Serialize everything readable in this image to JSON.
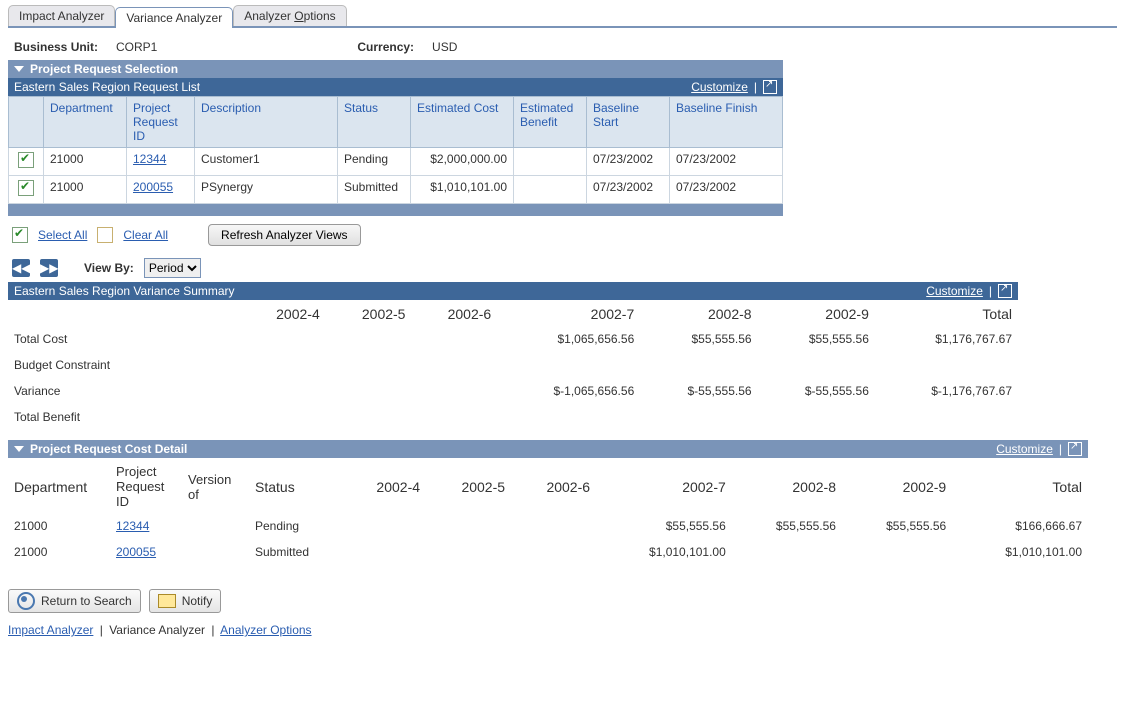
{
  "tabs": {
    "impact": "Impact Analyzer",
    "variance": "Variance Analyzer",
    "options": "Analyzer Options"
  },
  "header": {
    "bu_label": "Business Unit:",
    "bu": "CORP1",
    "curr_label": "Currency:",
    "curr": "USD"
  },
  "section1": {
    "title": "Project Request Selection"
  },
  "reqlist": {
    "title": "Eastern Sales Region Request List",
    "customize": "Customize",
    "cols": {
      "dept": "Department",
      "prid": "Project Request ID",
      "desc": "Description",
      "status": "Status",
      "ecost": "Estimated Cost",
      "ebenefit": "Estimated Benefit",
      "bstart": "Baseline Start",
      "bfinish": "Baseline Finish"
    },
    "rows": [
      {
        "dept": "21000",
        "prid": "12344",
        "desc": "Customer1",
        "status": "Pending",
        "ecost": "$2,000,000.00",
        "ebenefit": "",
        "bstart": "07/23/2002",
        "bfinish": "07/23/2002"
      },
      {
        "dept": "21000",
        "prid": "200055",
        "desc": "PSynergy",
        "status": "Submitted",
        "ecost": "$1,010,101.00",
        "ebenefit": "",
        "bstart": "07/23/2002",
        "bfinish": "07/23/2002"
      }
    ]
  },
  "controls": {
    "select_all": "Select All",
    "clear_all": "Clear All",
    "refresh": "Refresh Analyzer Views"
  },
  "viewby": {
    "label": "View By:",
    "value": "Period",
    "options": [
      "Period"
    ]
  },
  "summary": {
    "title": "Eastern Sales Region Variance Summary",
    "customize": "Customize",
    "cols": [
      "2002-4",
      "2002-5",
      "2002-6",
      "2002-7",
      "2002-8",
      "2002-9",
      "Total"
    ],
    "rows": [
      {
        "label": "Total Cost",
        "vals": [
          "",
          "",
          "",
          "$1,065,656.56",
          "$55,555.56",
          "$55,555.56",
          "$1,176,767.67"
        ]
      },
      {
        "label": "Budget Constraint",
        "vals": [
          "",
          "",
          "",
          "",
          "",
          "",
          ""
        ]
      },
      {
        "label": "Variance",
        "vals": [
          "",
          "",
          "",
          "$-1,065,656.56",
          "$-55,555.56",
          "$-55,555.56",
          "$-1,176,767.67"
        ]
      },
      {
        "label": "Total Benefit",
        "vals": [
          "",
          "",
          "",
          "",
          "",
          "",
          ""
        ]
      }
    ]
  },
  "detail": {
    "title": "Project Request Cost Detail",
    "customize": "Customize",
    "cols": {
      "dept": "Department",
      "prid": "Project Request ID",
      "ver": "Version of",
      "status": "Status"
    },
    "period_cols": [
      "2002-4",
      "2002-5",
      "2002-6",
      "2002-7",
      "2002-8",
      "2002-9",
      "Total"
    ],
    "rows": [
      {
        "dept": "21000",
        "prid": "12344",
        "ver": "",
        "status": "Pending",
        "vals": [
          "",
          "",
          "",
          "$55,555.56",
          "$55,555.56",
          "$55,555.56",
          "$166,666.67"
        ]
      },
      {
        "dept": "21000",
        "prid": "200055",
        "ver": "",
        "status": "Submitted",
        "vals": [
          "",
          "",
          "",
          "$1,010,101.00",
          "",
          "",
          "$1,010,101.00"
        ]
      }
    ]
  },
  "bottom": {
    "rts": "Return to Search",
    "notify": "Notify"
  },
  "footer_links": {
    "impact": "Impact Analyzer",
    "variance": "Variance Analyzer",
    "options": "Analyzer Options"
  },
  "chart_data": {
    "type": "table",
    "title": "Eastern Sales Region Variance Summary",
    "categories": [
      "2002-4",
      "2002-5",
      "2002-6",
      "2002-7",
      "2002-8",
      "2002-9",
      "Total"
    ],
    "series": [
      {
        "name": "Total Cost",
        "values": [
          null,
          null,
          null,
          1065656.56,
          55555.56,
          55555.56,
          1176767.67
        ]
      },
      {
        "name": "Budget Constraint",
        "values": [
          null,
          null,
          null,
          null,
          null,
          null,
          null
        ]
      },
      {
        "name": "Variance",
        "values": [
          null,
          null,
          null,
          -1065656.56,
          -55555.56,
          -55555.56,
          -1176767.67
        ]
      },
      {
        "name": "Total Benefit",
        "values": [
          null,
          null,
          null,
          null,
          null,
          null,
          null
        ]
      }
    ]
  }
}
